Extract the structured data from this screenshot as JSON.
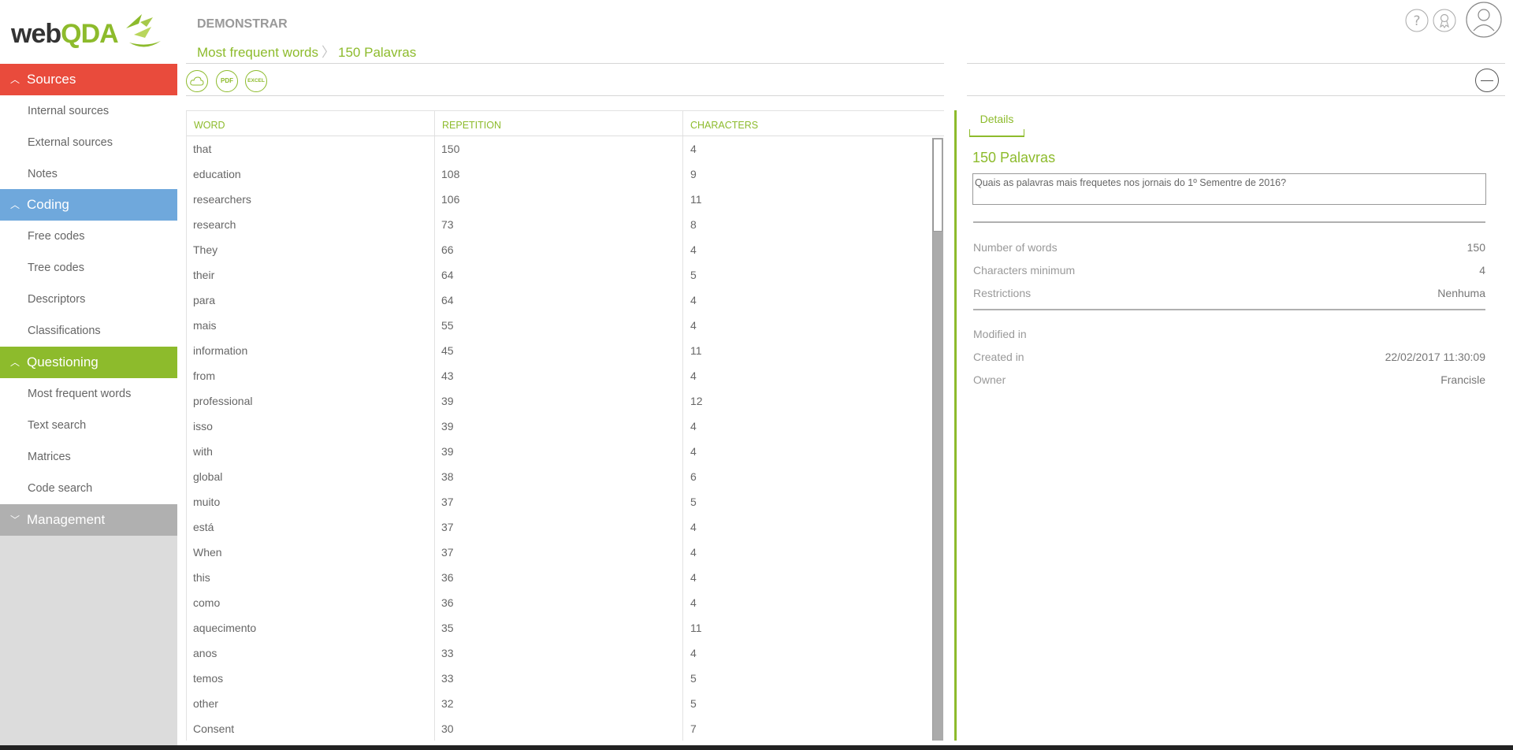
{
  "logo": {
    "web": "web",
    "qda": "QDA"
  },
  "project_name": "DEMONSTRAR",
  "breadcrumb": {
    "section": "Most frequent words",
    "current": "150 Palavras"
  },
  "sidebar": {
    "sections": [
      {
        "label": "Sources",
        "color": "#e94b3c",
        "items": [
          "Internal sources",
          "External sources",
          "Notes"
        ]
      },
      {
        "label": "Coding",
        "color": "#6fa8dc",
        "items": [
          "Free codes",
          "Tree codes",
          "Descriptors",
          "Classifications"
        ]
      },
      {
        "label": "Questioning",
        "color": "#8dbb2c",
        "items": [
          "Most frequent words",
          "Text search",
          "Matrices",
          "Code search"
        ]
      },
      {
        "label": "Management",
        "color": "#b0b0b0",
        "items": []
      }
    ]
  },
  "toolbar": {
    "pdf": "PDF",
    "excel": "EXCEL"
  },
  "table": {
    "headers": {
      "word": "WORD",
      "repetition": "REPETITION",
      "characters": "CHARACTERS"
    },
    "rows": [
      [
        "that",
        "150",
        "4"
      ],
      [
        "education",
        "108",
        "9"
      ],
      [
        "researchers",
        "106",
        "11"
      ],
      [
        "research",
        "73",
        "8"
      ],
      [
        "They",
        "66",
        "4"
      ],
      [
        "their",
        "64",
        "5"
      ],
      [
        "para",
        "64",
        "4"
      ],
      [
        "mais",
        "55",
        "4"
      ],
      [
        "information",
        "45",
        "11"
      ],
      [
        "from",
        "43",
        "4"
      ],
      [
        "professional",
        "39",
        "12"
      ],
      [
        "isso",
        "39",
        "4"
      ],
      [
        "with",
        "39",
        "4"
      ],
      [
        "global",
        "38",
        "6"
      ],
      [
        "muito",
        "37",
        "5"
      ],
      [
        "está",
        "37",
        "4"
      ],
      [
        "When",
        "37",
        "4"
      ],
      [
        "this",
        "36",
        "4"
      ],
      [
        "como",
        "36",
        "4"
      ],
      [
        "aquecimento",
        "35",
        "11"
      ],
      [
        "anos",
        "33",
        "4"
      ],
      [
        "temos",
        "33",
        "5"
      ],
      [
        "other",
        "32",
        "5"
      ],
      [
        "Consent",
        "30",
        "7"
      ]
    ]
  },
  "details": {
    "tab": "Details",
    "title": "150 Palavras",
    "question": "Quais as palavras mais frequetes nos jornais do 1º Sementre de 2016?",
    "number_of_words_label": "Number of words",
    "number_of_words": "150",
    "characters_minimum_label": "Characters minimum",
    "characters_minimum": "4",
    "restrictions_label": "Restrictions",
    "restrictions": "Nenhuma",
    "modified_label": "Modified in",
    "modified": "",
    "created_label": "Created in",
    "created": "22/02/2017 11:30:09",
    "owner_label": "Owner",
    "owner": "Francisle"
  },
  "icons": [
    "help-icon",
    "badge-icon",
    "user-avatar-icon",
    "cloud-icon",
    "chevron-up-icon",
    "chevron-down-icon",
    "minus-icon"
  ]
}
